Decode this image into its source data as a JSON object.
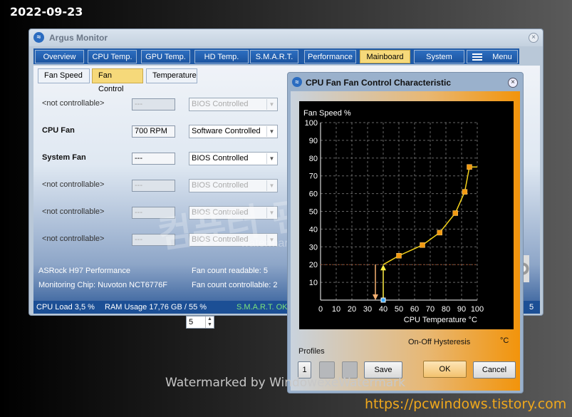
{
  "overlay": {
    "date": "2022-09-23",
    "watermark_bottom": "Watermarked by WindowexeWatermark",
    "url": "https://pcwindows.tistory.com",
    "watermark_small": "watermark by windowexe"
  },
  "main_window": {
    "title": "Argus Monitor",
    "tabs": [
      "Overview",
      "CPU Temp.",
      "GPU Temp.",
      "HD Temp.",
      "S.M.A.R.T.",
      "Performance",
      "Mainboard",
      "System",
      "Menu"
    ],
    "active_tab": "Mainboard",
    "subtabs": [
      "Fan Speed",
      "Fan Control",
      "Temperature"
    ],
    "active_subtab": "Fan Control",
    "fans": [
      {
        "label": "<not controllable>",
        "rpm": "---",
        "mode": "BIOS Controlled"
      },
      {
        "label": "CPU Fan",
        "rpm": "700 RPM",
        "mode": "Software Controlled"
      },
      {
        "label": "System Fan",
        "rpm": "---",
        "mode": "BIOS Controlled"
      },
      {
        "label": "<not controllable>",
        "rpm": "---",
        "mode": "BIOS Controlled"
      },
      {
        "label": "<not controllable>",
        "rpm": "---",
        "mode": "BIOS Controlled"
      },
      {
        "label": "<not controllable>",
        "rpm": "---",
        "mode": "BIOS Controlled"
      }
    ],
    "board": "ASRock H97 Performance",
    "chip": "Monitoring Chip: Nuvoton NCT6776F",
    "fan_readable": "Fan count readable: 5",
    "fan_controllable": "Fan count controllable: 2",
    "status": {
      "cpu_load": "CPU Load 3,5 %",
      "ram": "RAM Usage 17,76 GB / 55 %",
      "smart": "S.M.A.R.T. OK",
      "tail": "5"
    }
  },
  "dialog": {
    "title": "CPU Fan Fan Control Characteristic",
    "hysteresis_label": "On-Off Hysteresis",
    "hysteresis_value": "5",
    "hysteresis_unit": "°C",
    "profiles_label": "Profiles",
    "profile_buttons": [
      "1",
      "",
      ""
    ],
    "save": "Save",
    "ok": "OK",
    "cancel": "Cancel"
  },
  "chart_data": {
    "type": "line",
    "title": "",
    "ylabel": "Fan Speed %",
    "xlabel": "CPU Temperature °C",
    "xlim": [
      0,
      100
    ],
    "ylim": [
      0,
      100
    ],
    "xticks": [
      0,
      10,
      20,
      30,
      40,
      50,
      60,
      70,
      80,
      90,
      100
    ],
    "yticks": [
      10,
      20,
      30,
      40,
      50,
      60,
      70,
      80,
      90,
      100
    ],
    "grid": true,
    "series": [
      {
        "x": [
          40,
          50,
          65,
          76,
          86,
          92,
          95,
          100
        ],
        "y": [
          20,
          25,
          31,
          38,
          49,
          61,
          75,
          75
        ]
      }
    ],
    "hysteresis": {
      "on_temp": 40,
      "off_temp": 35,
      "level": 20
    },
    "current_point": {
      "x": 40,
      "y": 0
    },
    "colors": {
      "line": "#f4d21a",
      "points": "#f39a12",
      "grid": "#666666",
      "current": "#39a8ff",
      "hyst": "#f5b070",
      "up_arrow": "#ffee44"
    }
  }
}
